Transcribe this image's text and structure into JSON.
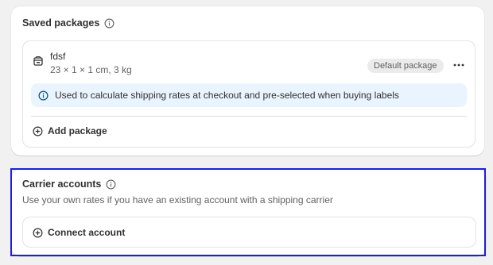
{
  "saved_packages": {
    "title": "Saved packages",
    "package": {
      "name": "fdsf",
      "dimensions": "23 × 1 × 1 cm, 3 kg",
      "badge": "Default package"
    },
    "banner_text": "Used to calculate shipping rates at checkout and pre-selected when buying labels",
    "add_label": "Add package"
  },
  "carrier_accounts": {
    "title": "Carrier accounts",
    "subtitle": "Use your own rates if you have an existing account with a shipping carrier",
    "connect_label": "Connect account"
  },
  "colors": {
    "focus_ring": "#1f1fd6",
    "banner_bg": "#eaf4ff",
    "badge_bg": "#ebebeb"
  },
  "icons": [
    "info-icon",
    "package-icon",
    "more-horizontal-icon",
    "plus-circle-icon"
  ]
}
